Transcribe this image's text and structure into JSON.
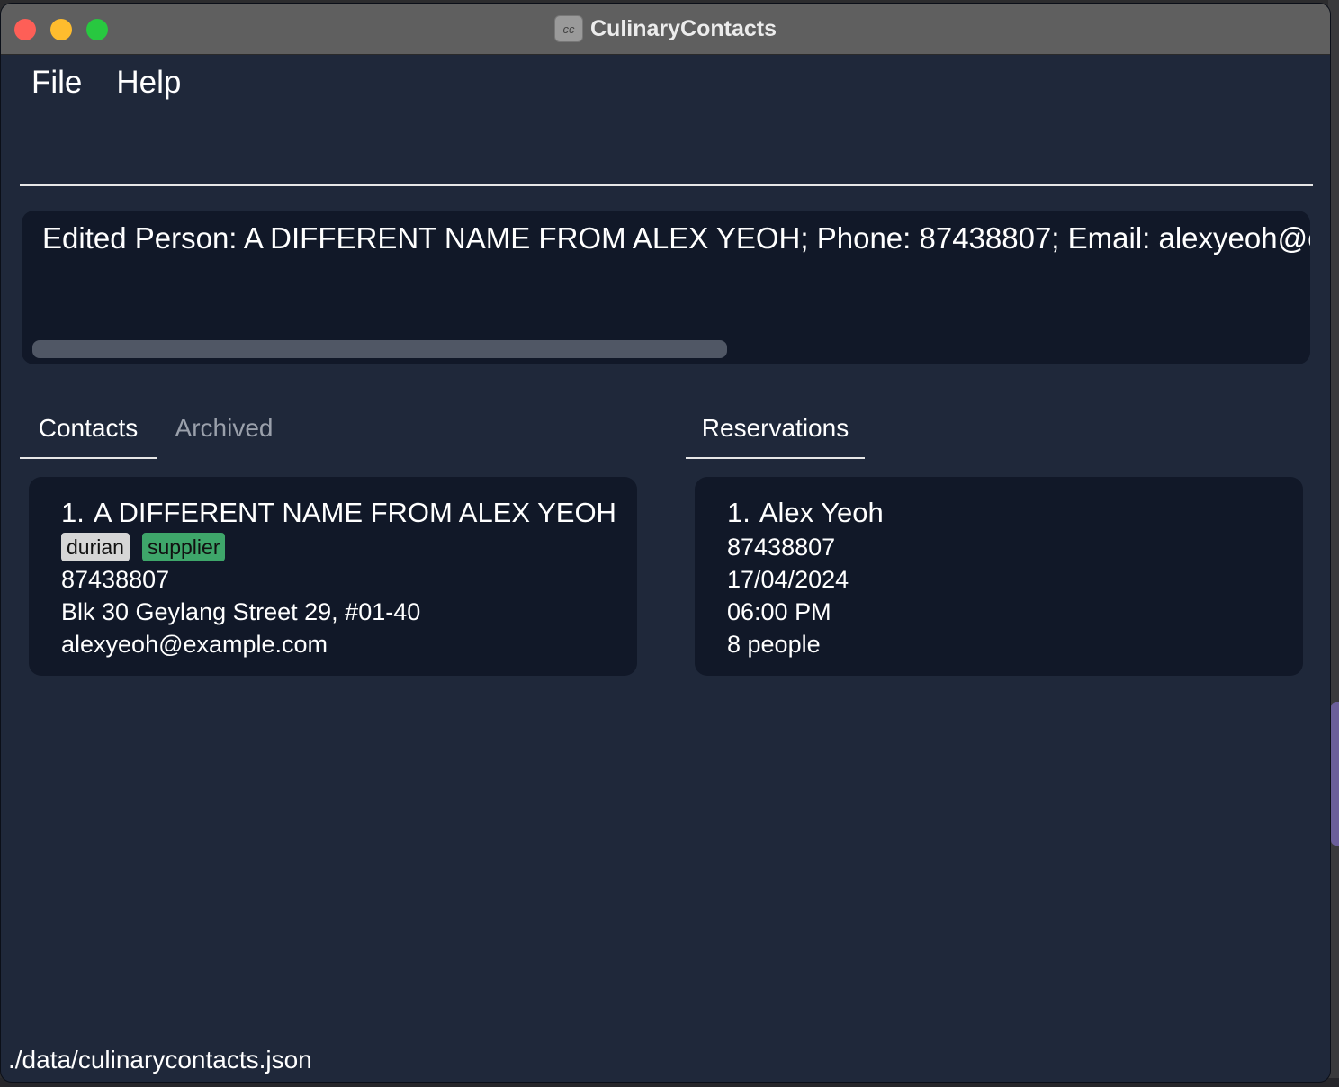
{
  "window": {
    "title": "CulinaryContacts",
    "app_icon": "culinary-app-icon"
  },
  "menu": {
    "file": "File",
    "help": "Help"
  },
  "command_box": {
    "value": ""
  },
  "result": {
    "text": "Edited Person: A DIFFERENT NAME FROM ALEX YEOH; Phone: 87438807; Email: alexyeoh@exa"
  },
  "tabs": {
    "contacts": "Contacts",
    "archived": "Archived",
    "reservations": "Reservations"
  },
  "contacts": [
    {
      "index": "1.",
      "name": "A DIFFERENT NAME FROM ALEX YEOH",
      "tags": [
        "durian",
        "supplier"
      ],
      "phone": "87438807",
      "address": "Blk 30 Geylang Street 29, #01-40",
      "email": "alexyeoh@example.com"
    }
  ],
  "reservations": [
    {
      "index": "1.",
      "name": "Alex Yeoh",
      "phone": "87438807",
      "date": "17/04/2024",
      "time": "06:00 PM",
      "pax": "8 people"
    }
  ],
  "status": {
    "file_path": "./data/culinarycontacts.json"
  },
  "colors": {
    "background": "#1f283a",
    "panel": "#111828",
    "tag_durian": "#d6d6d6",
    "tag_supplier": "#3ea66a"
  }
}
